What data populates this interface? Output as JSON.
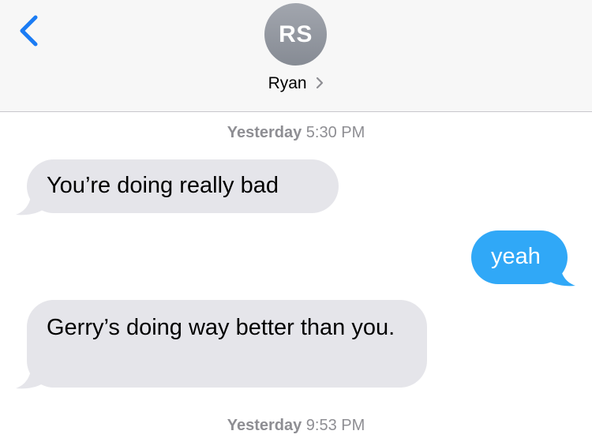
{
  "header": {
    "back_icon": "chevron-left-icon",
    "avatar_initials": "RS",
    "contact_name": "Ryan",
    "contact_chevron_icon": "chevron-right-icon",
    "accent_color": "#1b7cf4"
  },
  "messages": [
    {
      "direction": "received",
      "text": "You’re doing really bad"
    },
    {
      "direction": "sent",
      "text": "yeah"
    },
    {
      "direction": "received",
      "text": "Gerry’s doing way better than you."
    }
  ],
  "timestamps": [
    {
      "day": "Yesterday",
      "time": "5:30 PM"
    },
    {
      "day": "Yesterday",
      "time": "9:53 PM"
    }
  ],
  "colors": {
    "received_bubble": "#e5e5ea",
    "sent_bubble": "#30a8f7",
    "timestamp_text": "#8e8e93"
  }
}
